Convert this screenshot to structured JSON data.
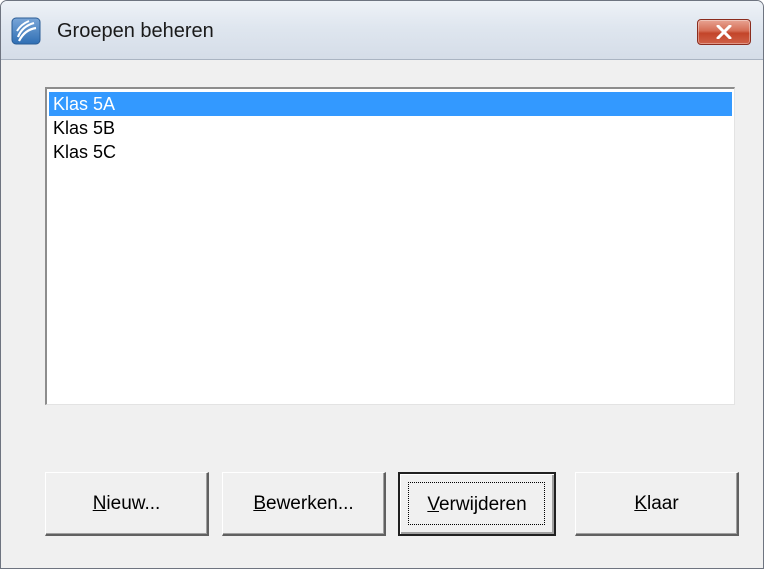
{
  "window": {
    "title": "Groepen beheren",
    "icon": "app-icon",
    "close_icon": "close-icon"
  },
  "groups_list": {
    "items": [
      "Klas 5A",
      "Klas 5B",
      "Klas 5C"
    ],
    "selected_index": 0,
    "selection_color": "#3399ff"
  },
  "buttons": {
    "new": {
      "accel": "N",
      "rest": "ieuw..."
    },
    "edit": {
      "accel": "B",
      "rest": "ewerken..."
    },
    "delete": {
      "accel": "V",
      "rest": "erwijderen"
    },
    "done": {
      "accel": "K",
      "rest": "laar"
    }
  }
}
